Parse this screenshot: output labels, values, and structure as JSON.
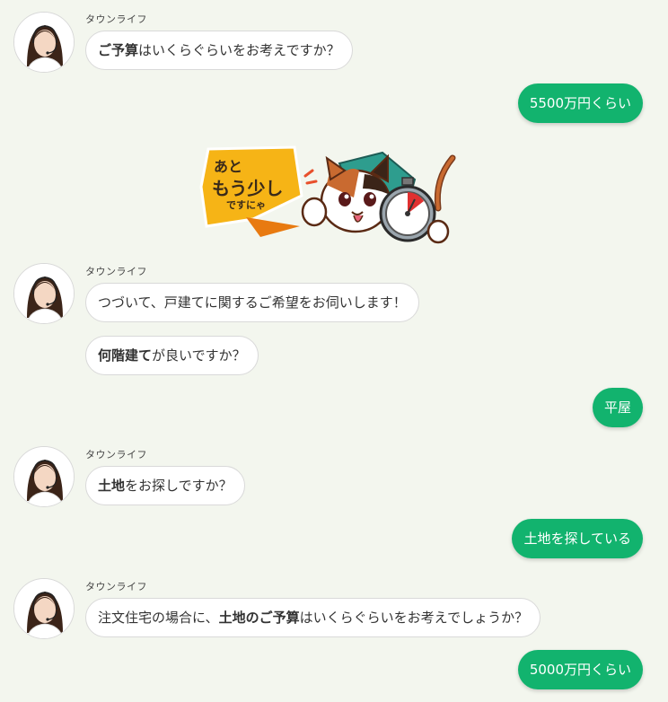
{
  "sender_name": "タウンライフ",
  "messages": [
    {
      "side": "left",
      "parts": [
        {
          "text": "ご予算",
          "bold": true
        },
        {
          "text": "はいくらぐらいをお考えですか？",
          "bold": false
        }
      ]
    },
    {
      "side": "right",
      "text": "5500万円くらい"
    },
    {
      "side": "left",
      "parts": [
        {
          "text": "つづいて、戸建てに関するご希望をお伺いします！",
          "bold": false
        }
      ]
    },
    {
      "side": "left",
      "parts": [
        {
          "text": "何階建て",
          "bold": true
        },
        {
          "text": "が良いですか？",
          "bold": false
        }
      ]
    },
    {
      "side": "right",
      "text": "平屋"
    },
    {
      "side": "left",
      "parts": [
        {
          "text": "土地",
          "bold": true
        },
        {
          "text": "をお探しですか？",
          "bold": false
        }
      ]
    },
    {
      "side": "right",
      "text": "土地を探している"
    },
    {
      "side": "left",
      "parts": [
        {
          "text": "注文住宅の場合に、",
          "bold": false
        },
        {
          "text": "土地のご予算",
          "bold": true
        },
        {
          "text": "はいくらぐらいをお考えでしょうか？",
          "bold": false
        }
      ]
    },
    {
      "side": "right",
      "text": "5000万円くらい"
    }
  ],
  "sticker": {
    "line1": "あと",
    "line2": "もう少し",
    "line3": "ですにゃ"
  },
  "colors": {
    "accent_green": "#12b36e",
    "background": "#f3f6ee",
    "sticker_yellow": "#f6b416"
  }
}
